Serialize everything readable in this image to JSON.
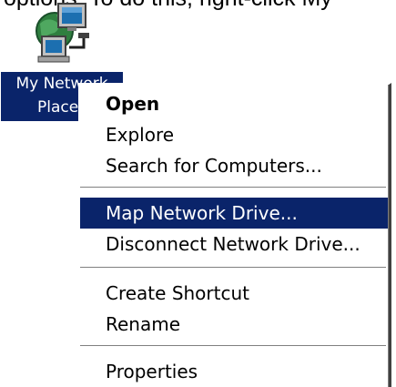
{
  "top_text": "options. To do this, right-click My",
  "desktop_icon": {
    "icon": "my-network-places-icon",
    "label_line1": "My Network",
    "label_line2": "Places"
  },
  "context_menu": {
    "items": [
      {
        "label": "Open",
        "bold": true
      },
      {
        "label": "Explore"
      },
      {
        "label": "Search for Computers..."
      },
      {
        "label": "Map Network Drive...",
        "highlighted": true
      },
      {
        "label": "Disconnect Network Drive..."
      },
      {
        "label": "Create Shortcut"
      },
      {
        "label": "Rename"
      },
      {
        "label": "Properties"
      }
    ],
    "highlight_color": "#0a246a"
  }
}
